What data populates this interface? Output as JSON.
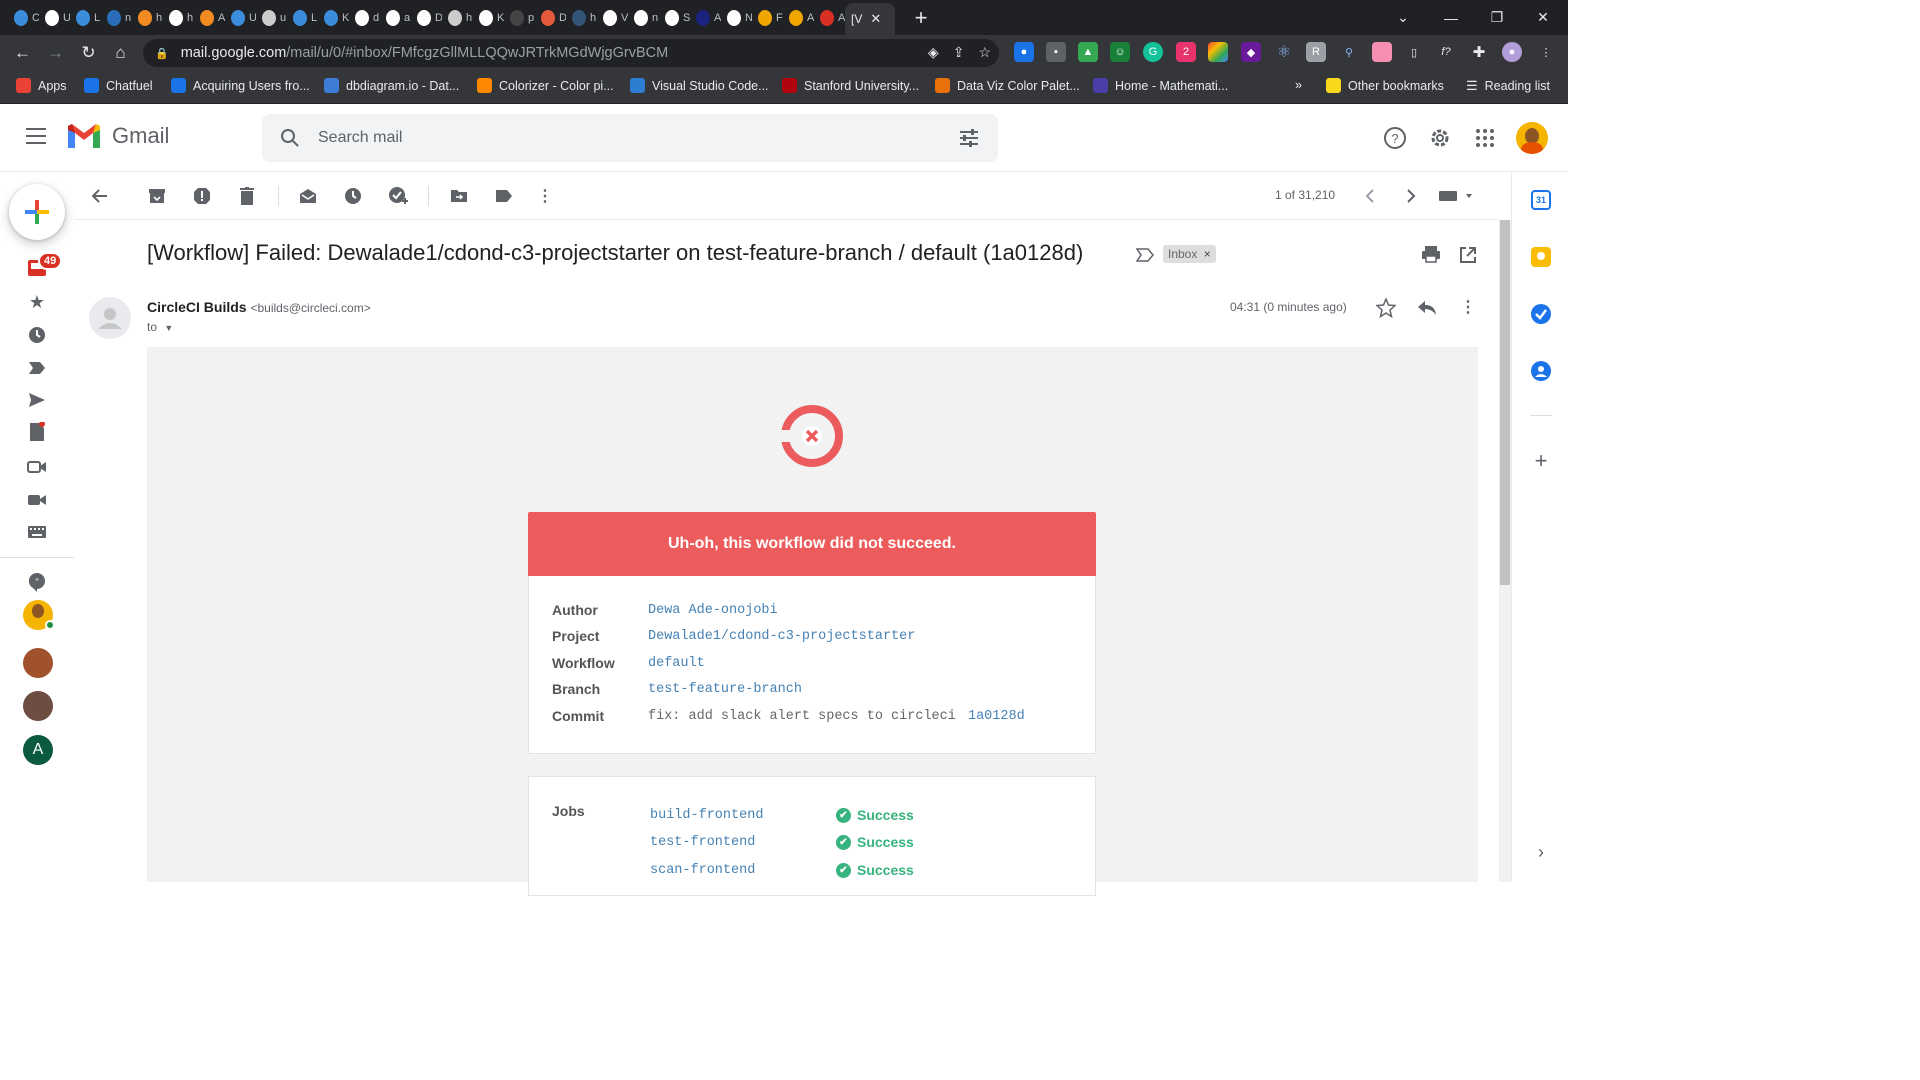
{
  "browser": {
    "tabs": [
      {
        "letter": "C",
        "color": "#3c8cdc"
      },
      {
        "letter": "U",
        "color": "#ffffff"
      },
      {
        "letter": "L",
        "color": "#3c8cdc"
      },
      {
        "letter": "n",
        "color": "#2a6ebb"
      },
      {
        "letter": "h",
        "color": "#f28b22"
      },
      {
        "letter": "h",
        "color": "#ffffff"
      },
      {
        "letter": "A",
        "color": "#f28b22"
      },
      {
        "letter": "U",
        "color": "#3c8cdc"
      },
      {
        "letter": "u",
        "color": "#cccccc"
      },
      {
        "letter": "L",
        "color": "#3c8cdc"
      },
      {
        "letter": "K",
        "color": "#3c8cdc"
      },
      {
        "letter": "d",
        "color": "#ffffff"
      },
      {
        "letter": "a",
        "color": "#ffffff"
      },
      {
        "letter": "D",
        "color": "#ffffff"
      },
      {
        "letter": "h",
        "color": "#cccccc"
      },
      {
        "letter": "K",
        "color": "#ffffff"
      },
      {
        "letter": "p",
        "color": "#444444"
      },
      {
        "letter": "D",
        "color": "#e55a3a"
      },
      {
        "letter": "h",
        "color": "#335577"
      },
      {
        "letter": "V",
        "color": "#ffffff"
      },
      {
        "letter": "n",
        "color": "#ffffff"
      },
      {
        "letter": "S",
        "color": "#ffffff"
      },
      {
        "letter": "A",
        "color": "#1a237e"
      },
      {
        "letter": "N",
        "color": "#ffffff"
      },
      {
        "letter": "F",
        "color": "#f0a500"
      },
      {
        "letter": "A",
        "color": "#f0a500"
      },
      {
        "letter": "A",
        "color": "#d93025"
      }
    ],
    "active_tab": {
      "letter": "[V"
    },
    "new_tab": "+",
    "url_host": "mail.google.com",
    "url_path": "/mail/u/0/#inbox/FMfcgzGllMLLQQwJRTrkMGdWjgGrvBCM",
    "bookmarks": [
      {
        "label": "Apps",
        "color": "#ea4335"
      },
      {
        "label": "Chatfuel",
        "color": "#1a73e8"
      },
      {
        "label": "Acquiring Users fro...",
        "color": "#1a73e8"
      },
      {
        "label": "dbdiagram.io - Dat...",
        "color": "#3d7dd8"
      },
      {
        "label": "Colorizer - Color pi...",
        "color": "#ff8800"
      },
      {
        "label": "Visual Studio Code...",
        "color": "#2d7dd2"
      },
      {
        "label": "Stanford University...",
        "color": "#b1040e"
      },
      {
        "label": "Data Viz Color Palet...",
        "color": "#e8710a"
      },
      {
        "label": "Home - Mathemati...",
        "color": "#4b3ea8"
      }
    ],
    "bookmarks_more": "»",
    "other_bookmarks": "Other bookmarks",
    "reading_list": "Reading list"
  },
  "gmail": {
    "brand": "Gmail",
    "search_placeholder": "Search mail",
    "unread_count": "49",
    "pager": "1 of 31,210",
    "subject": "[Workflow] Failed: Dewalade1/cdond-c3-projectstarter on test-feature-branch / default (1a0128d)",
    "label_chip": "Inbox",
    "label_chip_close": "×",
    "sender_name": "CircleCI Builds",
    "sender_email": "<builds@circleci.com>",
    "to": "to",
    "time": "04:31 (0 minutes ago)",
    "rail_avatar_letter": "A"
  },
  "email": {
    "banner": "Uh-oh, this workflow did not succeed.",
    "details": [
      {
        "label": "Author",
        "value": "Dewa Ade-onojobi"
      },
      {
        "label": "Project",
        "value": "Dewalade1/cdond-c3-projectstarter"
      },
      {
        "label": "Workflow",
        "value": "default"
      },
      {
        "label": "Branch",
        "value": "test-feature-branch"
      },
      {
        "label": "Commit",
        "value": "fix: add slack alert specs to circleci",
        "link": "1a0128d"
      }
    ],
    "jobs_label": "Jobs",
    "jobs": [
      {
        "name": "build-frontend",
        "status": "Success"
      },
      {
        "name": "test-frontend",
        "status": "Success"
      },
      {
        "name": "scan-frontend",
        "status": "Success"
      }
    ]
  },
  "colors": {
    "failure_red": "#ed5c5c",
    "success_green": "#36b37e",
    "link_blue": "#4682b4"
  }
}
